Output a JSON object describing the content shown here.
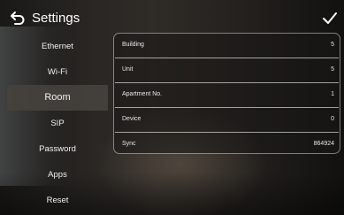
{
  "header": {
    "title": "Settings",
    "back_icon": "back-arrow-icon",
    "confirm_icon": "checkmark-icon"
  },
  "menu": {
    "items": [
      {
        "label": "Ethernet",
        "active": false
      },
      {
        "label": "Wi-Fi",
        "active": false
      },
      {
        "label": "Room",
        "active": true
      },
      {
        "label": "SIP",
        "active": false
      },
      {
        "label": "Password",
        "active": false
      },
      {
        "label": "Apps",
        "active": false
      },
      {
        "label": "Reset",
        "active": false
      }
    ]
  },
  "room": {
    "rows": [
      {
        "label": "Building",
        "value": "5"
      },
      {
        "label": "Unit",
        "value": "5"
      },
      {
        "label": "Apartment No.",
        "value": "1"
      },
      {
        "label": "Device",
        "value": "0"
      },
      {
        "label": "Sync",
        "value": "864924"
      }
    ]
  }
}
